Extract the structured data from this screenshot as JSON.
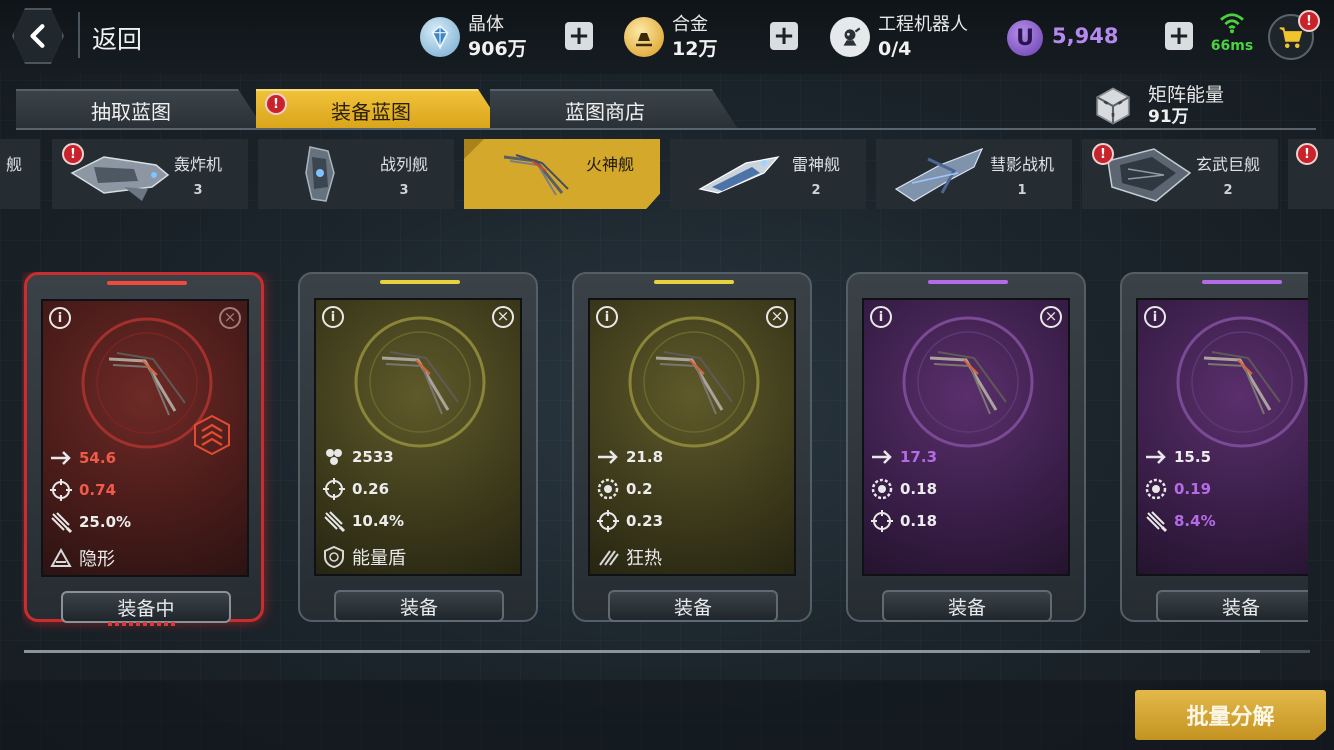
{
  "topbar": {
    "back_label": "返回",
    "crystal": {
      "name": "晶体",
      "value": "906万"
    },
    "alloy": {
      "name": "合金",
      "value": "12万"
    },
    "robot": {
      "name": "工程机器人",
      "value": "0/4"
    },
    "u_currency": {
      "icon_letter": "U",
      "value": "5,948"
    },
    "ping": "66ms",
    "cart_alert": "!"
  },
  "tabs": [
    {
      "label": "抽取蓝图",
      "active": false
    },
    {
      "label": "装备蓝图",
      "active": true,
      "alert": "!"
    },
    {
      "label": "蓝图商店",
      "active": false
    }
  ],
  "matrix": {
    "name": "矩阵能量",
    "value": "91万"
  },
  "ships": [
    {
      "name": "舰",
      "count": ""
    },
    {
      "name": "轰炸机",
      "count": "3",
      "alert": true
    },
    {
      "name": "战列舰",
      "count": "3"
    },
    {
      "name": "火神舰",
      "count": "",
      "active": true
    },
    {
      "name": "雷神舰",
      "count": "2"
    },
    {
      "name": "彗影战机",
      "count": "1"
    },
    {
      "name": "玄武巨舰",
      "count": "2",
      "alert": true
    }
  ],
  "cards": [
    {
      "rarity": "red",
      "stat1": "54.6",
      "stat2": "0.74",
      "stat3": "25.0%",
      "skill": "隐形",
      "button": "装备中"
    },
    {
      "rarity": "yellow",
      "stat1": "2533",
      "stat2": "0.26",
      "stat3": "10.4%",
      "skill": "能量盾",
      "button": "装备"
    },
    {
      "rarity": "yellow",
      "stat1": "21.8",
      "stat2": "0.2",
      "stat3": "0.23",
      "skill": "狂热",
      "button": "装备"
    },
    {
      "rarity": "purple",
      "stat1": "17.3",
      "stat2": "0.18",
      "stat3": "0.18",
      "skill": "",
      "button": "装备"
    },
    {
      "rarity": "purple",
      "stat1": "15.5",
      "stat2": "0.19",
      "stat3": "8.4%",
      "skill": "",
      "button": "装备"
    }
  ],
  "info_glyph": "i",
  "close_glyph": "×",
  "bulk_button": "批量分解",
  "colors": {
    "accent_gold": "#d4a82a",
    "red": "#f05a4a",
    "yellow": "#e6d23c",
    "purple": "#b46be8"
  }
}
